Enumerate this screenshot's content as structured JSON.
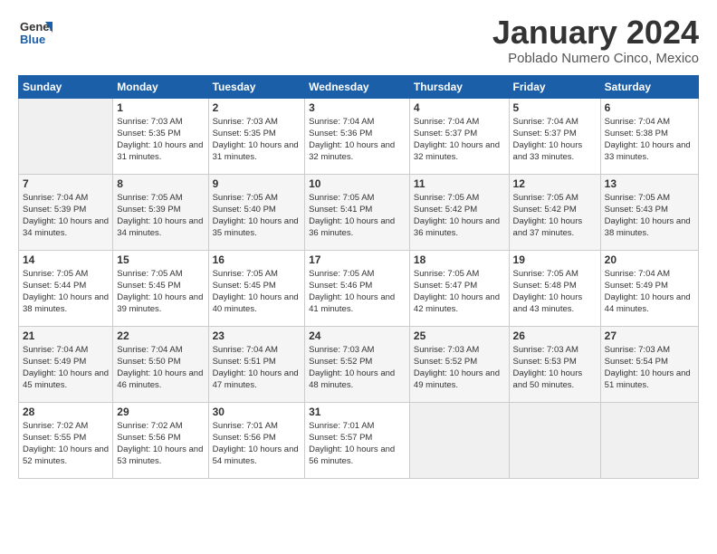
{
  "header": {
    "logo_general": "General",
    "logo_blue": "Blue",
    "month_title": "January 2024",
    "location": "Poblado Numero Cinco, Mexico"
  },
  "days_of_week": [
    "Sunday",
    "Monday",
    "Tuesday",
    "Wednesday",
    "Thursday",
    "Friday",
    "Saturday"
  ],
  "weeks": [
    [
      {
        "day": "",
        "sunrise": "",
        "sunset": "",
        "daylight": "",
        "empty": true
      },
      {
        "day": "1",
        "sunrise": "Sunrise: 7:03 AM",
        "sunset": "Sunset: 5:35 PM",
        "daylight": "Daylight: 10 hours and 31 minutes."
      },
      {
        "day": "2",
        "sunrise": "Sunrise: 7:03 AM",
        "sunset": "Sunset: 5:35 PM",
        "daylight": "Daylight: 10 hours and 31 minutes."
      },
      {
        "day": "3",
        "sunrise": "Sunrise: 7:04 AM",
        "sunset": "Sunset: 5:36 PM",
        "daylight": "Daylight: 10 hours and 32 minutes."
      },
      {
        "day": "4",
        "sunrise": "Sunrise: 7:04 AM",
        "sunset": "Sunset: 5:37 PM",
        "daylight": "Daylight: 10 hours and 32 minutes."
      },
      {
        "day": "5",
        "sunrise": "Sunrise: 7:04 AM",
        "sunset": "Sunset: 5:37 PM",
        "daylight": "Daylight: 10 hours and 33 minutes."
      },
      {
        "day": "6",
        "sunrise": "Sunrise: 7:04 AM",
        "sunset": "Sunset: 5:38 PM",
        "daylight": "Daylight: 10 hours and 33 minutes."
      }
    ],
    [
      {
        "day": "7",
        "sunrise": "Sunrise: 7:04 AM",
        "sunset": "Sunset: 5:39 PM",
        "daylight": "Daylight: 10 hours and 34 minutes."
      },
      {
        "day": "8",
        "sunrise": "Sunrise: 7:05 AM",
        "sunset": "Sunset: 5:39 PM",
        "daylight": "Daylight: 10 hours and 34 minutes."
      },
      {
        "day": "9",
        "sunrise": "Sunrise: 7:05 AM",
        "sunset": "Sunset: 5:40 PM",
        "daylight": "Daylight: 10 hours and 35 minutes."
      },
      {
        "day": "10",
        "sunrise": "Sunrise: 7:05 AM",
        "sunset": "Sunset: 5:41 PM",
        "daylight": "Daylight: 10 hours and 36 minutes."
      },
      {
        "day": "11",
        "sunrise": "Sunrise: 7:05 AM",
        "sunset": "Sunset: 5:42 PM",
        "daylight": "Daylight: 10 hours and 36 minutes."
      },
      {
        "day": "12",
        "sunrise": "Sunrise: 7:05 AM",
        "sunset": "Sunset: 5:42 PM",
        "daylight": "Daylight: 10 hours and 37 minutes."
      },
      {
        "day": "13",
        "sunrise": "Sunrise: 7:05 AM",
        "sunset": "Sunset: 5:43 PM",
        "daylight": "Daylight: 10 hours and 38 minutes."
      }
    ],
    [
      {
        "day": "14",
        "sunrise": "Sunrise: 7:05 AM",
        "sunset": "Sunset: 5:44 PM",
        "daylight": "Daylight: 10 hours and 38 minutes."
      },
      {
        "day": "15",
        "sunrise": "Sunrise: 7:05 AM",
        "sunset": "Sunset: 5:45 PM",
        "daylight": "Daylight: 10 hours and 39 minutes."
      },
      {
        "day": "16",
        "sunrise": "Sunrise: 7:05 AM",
        "sunset": "Sunset: 5:45 PM",
        "daylight": "Daylight: 10 hours and 40 minutes."
      },
      {
        "day": "17",
        "sunrise": "Sunrise: 7:05 AM",
        "sunset": "Sunset: 5:46 PM",
        "daylight": "Daylight: 10 hours and 41 minutes."
      },
      {
        "day": "18",
        "sunrise": "Sunrise: 7:05 AM",
        "sunset": "Sunset: 5:47 PM",
        "daylight": "Daylight: 10 hours and 42 minutes."
      },
      {
        "day": "19",
        "sunrise": "Sunrise: 7:05 AM",
        "sunset": "Sunset: 5:48 PM",
        "daylight": "Daylight: 10 hours and 43 minutes."
      },
      {
        "day": "20",
        "sunrise": "Sunrise: 7:04 AM",
        "sunset": "Sunset: 5:49 PM",
        "daylight": "Daylight: 10 hours and 44 minutes."
      }
    ],
    [
      {
        "day": "21",
        "sunrise": "Sunrise: 7:04 AM",
        "sunset": "Sunset: 5:49 PM",
        "daylight": "Daylight: 10 hours and 45 minutes."
      },
      {
        "day": "22",
        "sunrise": "Sunrise: 7:04 AM",
        "sunset": "Sunset: 5:50 PM",
        "daylight": "Daylight: 10 hours and 46 minutes."
      },
      {
        "day": "23",
        "sunrise": "Sunrise: 7:04 AM",
        "sunset": "Sunset: 5:51 PM",
        "daylight": "Daylight: 10 hours and 47 minutes."
      },
      {
        "day": "24",
        "sunrise": "Sunrise: 7:03 AM",
        "sunset": "Sunset: 5:52 PM",
        "daylight": "Daylight: 10 hours and 48 minutes."
      },
      {
        "day": "25",
        "sunrise": "Sunrise: 7:03 AM",
        "sunset": "Sunset: 5:52 PM",
        "daylight": "Daylight: 10 hours and 49 minutes."
      },
      {
        "day": "26",
        "sunrise": "Sunrise: 7:03 AM",
        "sunset": "Sunset: 5:53 PM",
        "daylight": "Daylight: 10 hours and 50 minutes."
      },
      {
        "day": "27",
        "sunrise": "Sunrise: 7:03 AM",
        "sunset": "Sunset: 5:54 PM",
        "daylight": "Daylight: 10 hours and 51 minutes."
      }
    ],
    [
      {
        "day": "28",
        "sunrise": "Sunrise: 7:02 AM",
        "sunset": "Sunset: 5:55 PM",
        "daylight": "Daylight: 10 hours and 52 minutes."
      },
      {
        "day": "29",
        "sunrise": "Sunrise: 7:02 AM",
        "sunset": "Sunset: 5:56 PM",
        "daylight": "Daylight: 10 hours and 53 minutes."
      },
      {
        "day": "30",
        "sunrise": "Sunrise: 7:01 AM",
        "sunset": "Sunset: 5:56 PM",
        "daylight": "Daylight: 10 hours and 54 minutes."
      },
      {
        "day": "31",
        "sunrise": "Sunrise: 7:01 AM",
        "sunset": "Sunset: 5:57 PM",
        "daylight": "Daylight: 10 hours and 56 minutes."
      },
      {
        "day": "",
        "sunrise": "",
        "sunset": "",
        "daylight": "",
        "empty": true
      },
      {
        "day": "",
        "sunrise": "",
        "sunset": "",
        "daylight": "",
        "empty": true
      },
      {
        "day": "",
        "sunrise": "",
        "sunset": "",
        "daylight": "",
        "empty": true
      }
    ]
  ]
}
